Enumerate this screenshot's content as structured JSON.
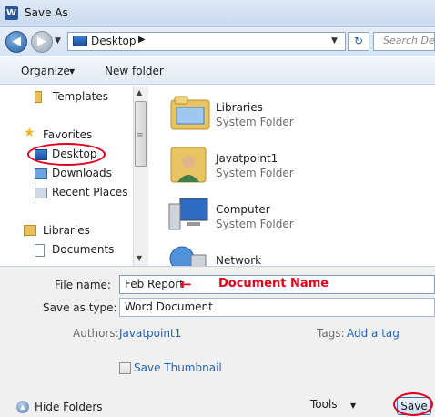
{
  "window": {
    "title": "Save As",
    "app_icon": "word-doc-icon"
  },
  "address": {
    "path": "Desktop",
    "search_placeholder": "Search Des"
  },
  "toolbar": {
    "organize": "Organize",
    "new_folder": "New folder"
  },
  "nav": {
    "items": [
      {
        "label": "Templates",
        "icon": "folder-icon"
      },
      {
        "label": "Favorites",
        "icon": "star-icon"
      },
      {
        "label": "Desktop",
        "icon": "desktop-icon"
      },
      {
        "label": "Downloads",
        "icon": "downloads-icon"
      },
      {
        "label": "Recent Places",
        "icon": "recent-places-icon"
      },
      {
        "label": "Libraries",
        "icon": "libraries-icon"
      },
      {
        "label": "Documents",
        "icon": "documents-icon"
      }
    ]
  },
  "files": [
    {
      "name": "Libraries",
      "type": "System Folder",
      "icon": "libraries-folder-icon"
    },
    {
      "name": "Javatpoint1",
      "type": "System Folder",
      "icon": "user-folder-icon"
    },
    {
      "name": "Computer",
      "type": "System Folder",
      "icon": "computer-icon"
    },
    {
      "name": "Network",
      "type": "",
      "icon": "network-icon"
    }
  ],
  "form": {
    "filename_label": "File name:",
    "filename_value": "Feb Report",
    "savetype_label": "Save as type:",
    "savetype_value": "Word Document",
    "authors_label": "Authors:",
    "authors_value": "Javatpoint1",
    "tags_label": "Tags:",
    "tags_value": "Add a tag",
    "thumbnail_label": "Save Thumbnail"
  },
  "annotation": {
    "arrow": "←",
    "text": "Document Name",
    "color": "#e0001b"
  },
  "footer": {
    "hide_folders": "Hide Folders",
    "tools": "Tools",
    "save": "Save"
  }
}
